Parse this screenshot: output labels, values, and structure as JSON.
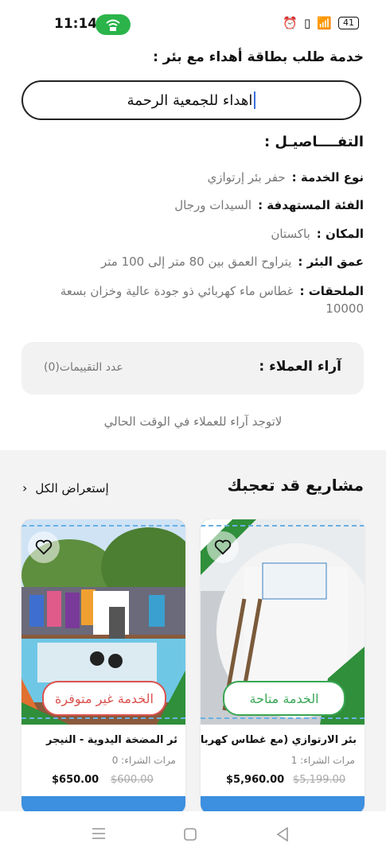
{
  "status_bar": {
    "time": "11:14",
    "battery": "41",
    "icons": [
      "alarm-icon",
      "vibrate-icon",
      "signal-icon",
      "battery-icon",
      "wifi-icon"
    ]
  },
  "service": {
    "heading": "خدمة طلب بطاقة أهداء مع بئر :",
    "gift_card_value": "اهداء للجمعية الرحمة"
  },
  "details": {
    "title": "التفــــاصيـل :",
    "rows": [
      {
        "label": "نوع الخدمة :",
        "value": "حفر بئر إرتوازي"
      },
      {
        "label": "الفئة المستهدفة :",
        "value": "السيدات ورجال"
      },
      {
        "label": "المكان :",
        "value": "باكستان"
      },
      {
        "label": "عمق البئر :",
        "value": "يتراوح العمق بين 80 متر إلى 100 متر"
      },
      {
        "label": "الملحقات :",
        "value": "غطاس ماء كهربائي ذو جودة عالية وخزان بسعة 10000"
      }
    ]
  },
  "reviews": {
    "title": "آراء العملاء :",
    "count_label": "عدد التقييمات(0)",
    "empty_message": "لاتوجد آراء للعملاء في الوقت الحالي"
  },
  "projects": {
    "title": "مشاريع قد تعجبك",
    "view_all": "إستعراض الكل",
    "cards": [
      {
        "title": "بئر الارتوازي (مع غطاس كهربا...",
        "status": "الخدمة متاحة",
        "purchases": "مرات الشراء: 1",
        "price": "$5,960.00",
        "old_price": "$5,199.00",
        "status_color": "#3aa655"
      },
      {
        "title": "ئر المضخة اليدوية - النيجر",
        "status": "الخدمة غير متوفرة",
        "purchases": "مرات الشراء: 0",
        "price": "$650.00",
        "old_price": "$600.00",
        "status_color": "#d9534f"
      }
    ]
  },
  "colors": {
    "accent_blue": "#3d8fe0",
    "green": "#2bb44a"
  }
}
